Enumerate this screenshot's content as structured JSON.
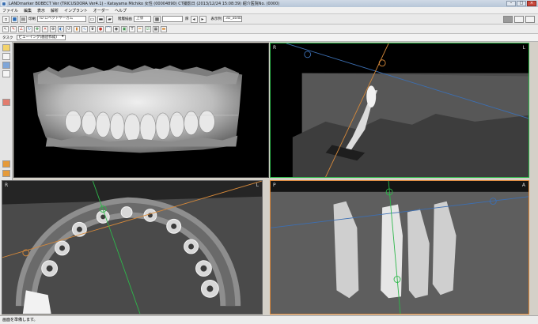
{
  "window": {
    "title": "LANDmarker BOBECT Ver (TRICUSDORA Ver4.1) - Katayama Michiko 女性 (00004890) CT撮影日 (2013/12/24 15:08:39) 紹介医院No. (0000)"
  },
  "menu": [
    "ファイル",
    "編集",
    "表示",
    "解析",
    "インプラント",
    "オーダー",
    "ヘルプ"
  ],
  "toolbar": {
    "print_label": "印刷",
    "patient_field": "ID ロペクトヤーカム",
    "window_label": "階層描画",
    "window_value": "上顎",
    "slice_label": "厚",
    "display_label": "表示列",
    "display_value": "3D_ab4b1"
  },
  "task": {
    "label": "タスク",
    "value": "ビューイング(歯冠作成)"
  },
  "viewports": {
    "coronal": {
      "left_label": "R",
      "right_label": "L"
    },
    "axial": {
      "left_label": "R",
      "right_label": "L"
    },
    "sagittal": {
      "left_label": "P",
      "right_label": "A"
    }
  },
  "status": {
    "text": "画面を準備します。"
  },
  "colors": {
    "coronal_frame": "#2db84a",
    "sagittal_frame": "#e0893a",
    "guide_blue": "#3c6fb3",
    "guide_orange": "#d6893a"
  }
}
